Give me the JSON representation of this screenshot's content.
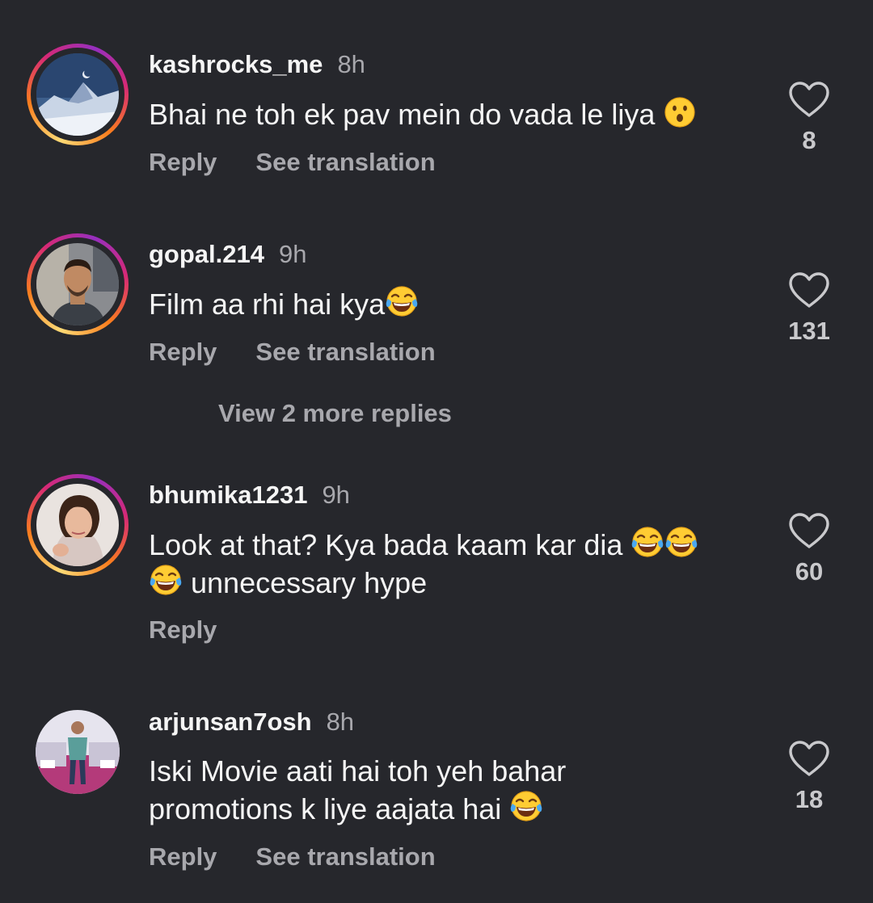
{
  "comments": [
    {
      "username": "kashrocks_me",
      "time": "8h",
      "text": "Bhai ne toh ek pav mein do vada le liya",
      "emoji": "hushed-face",
      "likes": "8",
      "reply_label": "Reply",
      "translate_label": "See translation",
      "has_story_ring": true
    },
    {
      "username": "gopal.214",
      "time": "9h",
      "text": "Film aa rhi hai kya",
      "emoji": "tears-of-joy",
      "likes": "131",
      "reply_label": "Reply",
      "translate_label": "See translation",
      "has_story_ring": true,
      "view_replies_label": "View 2 more replies"
    },
    {
      "username": "bhumika1231",
      "time": "9h",
      "text_line1": "Look at that? Kya bada kaam kar dia",
      "text_line2": "unnecessary hype",
      "emoji": "tears-of-joy",
      "likes": "60",
      "reply_label": "Reply",
      "has_story_ring": true
    },
    {
      "username": "arjunsan7osh",
      "time": "8h",
      "text_line1": "Iski Movie aati hai toh yeh bahar",
      "text_line2": "promotions k liye aajata hai",
      "emoji": "tears-of-joy",
      "likes": "18",
      "reply_label": "Reply",
      "translate_label": "See translation",
      "has_story_ring": false
    }
  ],
  "colors": {
    "background": "#26272c",
    "secondary_text": "#a8a8ad",
    "primary_text": "#f5f5f5"
  }
}
